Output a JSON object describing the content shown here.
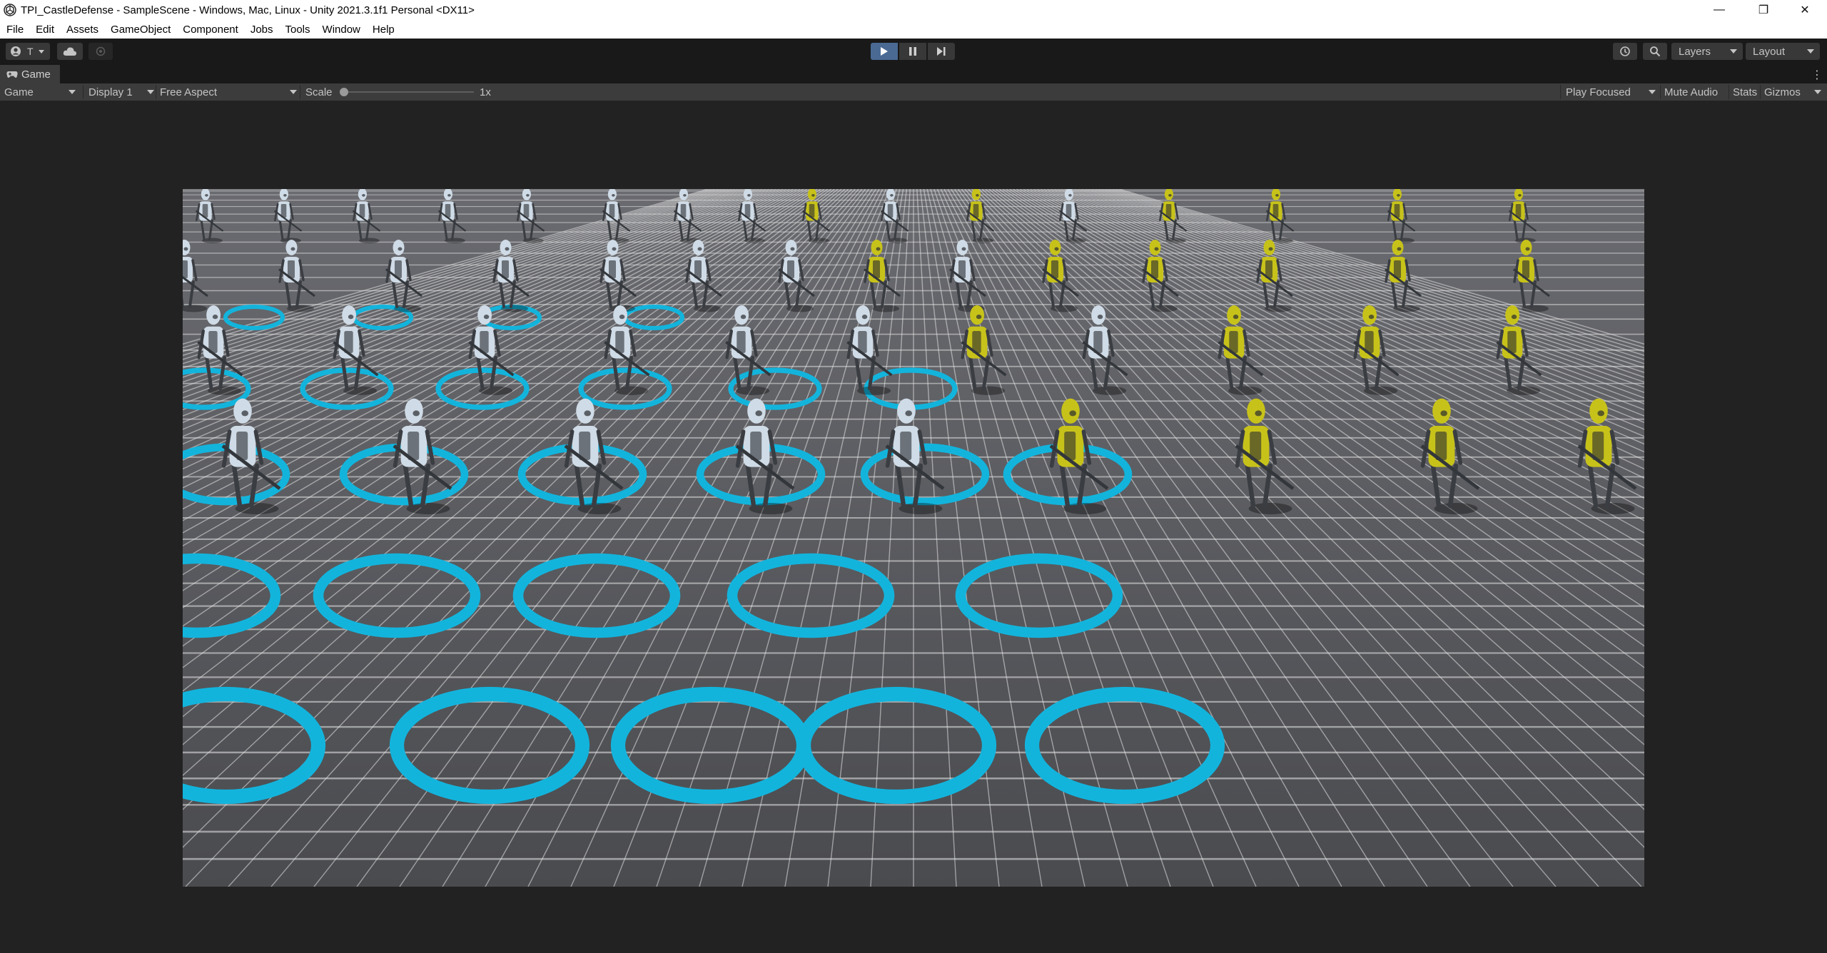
{
  "window": {
    "title": "TPI_CastleDefense - SampleScene - Windows, Mac, Linux - Unity 2021.3.1f1 Personal <DX11>",
    "controls": {
      "minimize": "—",
      "restore": "❐",
      "close": "✕"
    }
  },
  "menu": {
    "items": [
      "File",
      "Edit",
      "Assets",
      "GameObject",
      "Component",
      "Jobs",
      "Tools",
      "Window",
      "Help"
    ]
  },
  "toolbar": {
    "account_label": "T",
    "layers_label": "Layers",
    "layout_label": "Layout",
    "play_state": "playing",
    "icons": [
      "account-icon",
      "cloud-icon",
      "collab-icon",
      "play-icon",
      "pause-icon",
      "step-icon",
      "history-icon",
      "search-icon"
    ]
  },
  "tab": {
    "label": "Game"
  },
  "game_bar": {
    "view_mode": "Game",
    "display": "Display 1",
    "aspect": "Free Aspect",
    "scale_label": "Scale",
    "scale_value": "1x",
    "scale_fraction": 0.0,
    "play_mode": "Play Focused",
    "mute_audio": "Mute Audio",
    "stats": "Stats",
    "gizmos": "Gizmos"
  },
  "scene": {
    "description_colors": {
      "ground": "#55565a",
      "grid": "#e6e6e6",
      "selection_ring": "#13b4dc",
      "team_white": "#cfdbe6",
      "team_yellow": "#c7c21a"
    }
  }
}
